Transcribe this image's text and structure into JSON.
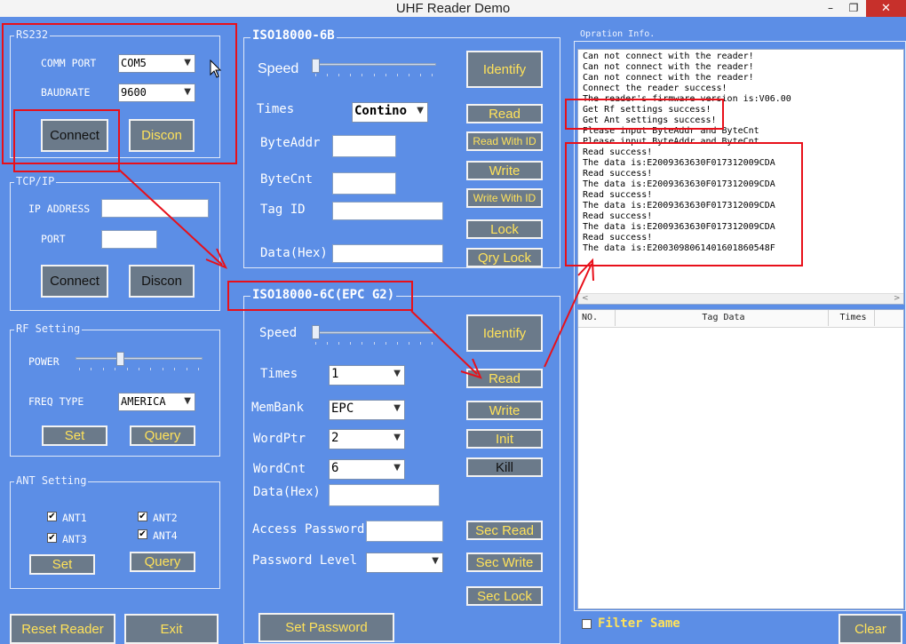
{
  "window": {
    "title": "UHF Reader Demo",
    "minimize": "–",
    "maximize": "❐",
    "close": "✕"
  },
  "rs232": {
    "title": "RS232",
    "comm_port_label": "COMM PORT",
    "comm_port_value": "COM5",
    "baudrate_label": "BAUDRATE",
    "baudrate_value": "9600",
    "connect": "Connect",
    "disconnect": "Discon"
  },
  "tcpip": {
    "title": "TCP/IP",
    "ip_label": "IP ADDRESS",
    "port_label": "PORT",
    "connect": "Connect",
    "disconnect": "Discon"
  },
  "rf": {
    "title": "RF Setting",
    "power_label": "POWER",
    "power_level": 0.34,
    "freq_label": "FREQ TYPE",
    "freq_value": "AMERICA",
    "set": "Set",
    "query": "Query"
  },
  "ant": {
    "title": "ANT Setting",
    "ants": [
      {
        "label": "ANT1",
        "checked": true
      },
      {
        "label": "ANT2",
        "checked": true
      },
      {
        "label": "ANT3",
        "checked": true
      },
      {
        "label": "ANT4",
        "checked": true
      }
    ],
    "set": "Set",
    "query": "Query"
  },
  "iso6b": {
    "title": "ISO18000-6B",
    "speed_label": "Speed",
    "speed_level": 0.0,
    "times_label": "Times",
    "times_value": "Contino",
    "byteaddr_label": "ByteAddr",
    "bytecnt_label": "ByteCnt",
    "tagid_label": "Tag ID",
    "data_label": "Data(Hex)",
    "identify": "Identify",
    "read": "Read",
    "read_with_id": "Read With ID",
    "write": "Write",
    "write_with_id": "Write With ID",
    "lock": "Lock",
    "query_lock": "Qry Lock"
  },
  "iso6c": {
    "title": "ISO18000-6C(EPC G2)",
    "speed_label": "Speed",
    "speed_level": 0.0,
    "times_label": "Times",
    "times_value": "1",
    "membank_label": "MemBank",
    "membank_value": "EPC",
    "wordptr_label": "WordPtr",
    "wordptr_value": "2",
    "wordcnt_label": "WordCnt",
    "wordcnt_value": "6",
    "data_label": "Data(Hex)",
    "access_password_label": "Access Password",
    "password_level_label": "Password Level",
    "identify": "Identify",
    "read": "Read",
    "write": "Write",
    "init": "Init",
    "kill": "Kill",
    "sec_read": "Sec Read",
    "sec_write": "Sec Write",
    "sec_lock": "Sec Lock",
    "set_password": "Set Password"
  },
  "info": {
    "title": "Opration Info.",
    "lines": [
      "Can not connect with the reader!",
      "Can not connect with the reader!",
      "Can not connect with the reader!",
      "Connect the reader success!",
      "The reader's firmware version is:V06.00",
      "Get Rf settings success!",
      "Get Ant settings success!",
      "Please input ByteAddr and ByteCnt",
      "Please input ByteAddr and ByteCnt",
      "Read success!",
      "The data is:E2009363630F017312009CDA",
      "Read success!",
      "The data is:E2009363630F017312009CDA",
      "Read success!",
      "The data is:E2009363630F017312009CDA",
      "Read success!",
      "The data is:E2009363630F017312009CDA",
      "Read success!",
      "The data is:E20030980614016018605​48F"
    ]
  },
  "table": {
    "headers": [
      "NO.",
      "Tag Data",
      "Times"
    ]
  },
  "bottom": {
    "filter_same": "Filter Same",
    "clear": "Clear",
    "reset_reader": "Reset Reader",
    "exit": "Exit"
  },
  "colors": {
    "background": "#5c8ee6",
    "button": "#6b7a8a",
    "button_text": "#ffe25a",
    "annotation": "#e8101a"
  }
}
